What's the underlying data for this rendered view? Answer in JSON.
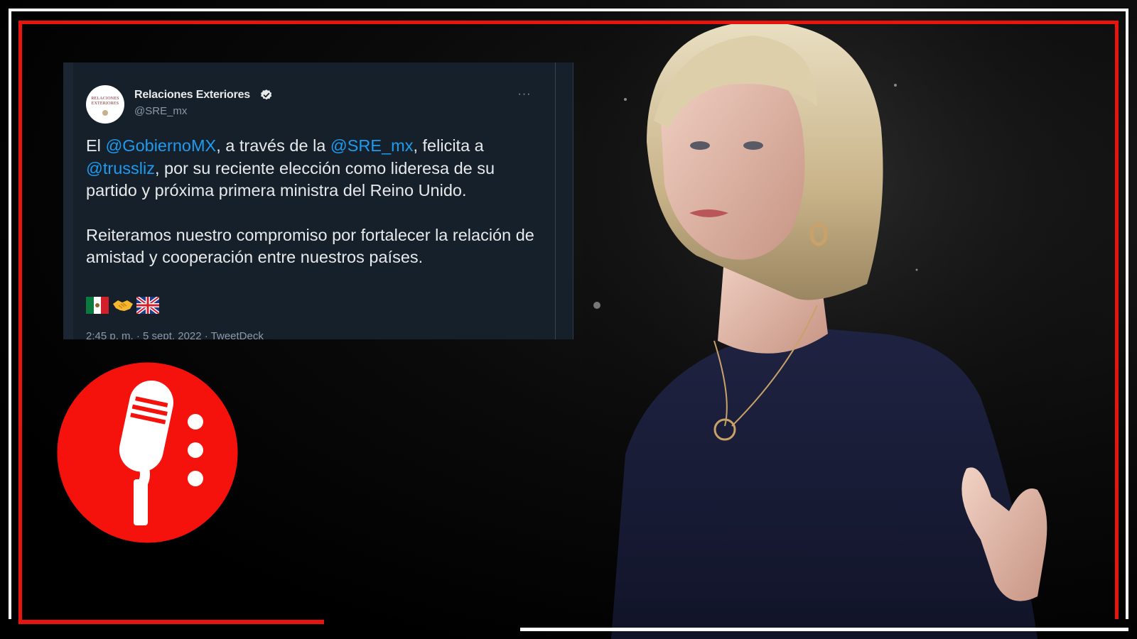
{
  "tweet": {
    "avatar_text": "RELACIONES EXTERIORES",
    "name": "Relaciones Exteriores",
    "handle": "@SRE_mx",
    "more_label": "···",
    "paragraph1": {
      "t1": "El ",
      "m1": "@GobiernoMX",
      "t2": ", a través de la ",
      "m2": "@SRE_mx",
      "t3": ", felicita a ",
      "m3": "@trussliz",
      "t4": ", por su reciente elección como lideresa de su partido y próxima primera ministra del Reino Unido."
    },
    "paragraph2": "Reiteramos nuestro compromiso por fortalecer la relación de amistad y cooperación entre nuestros países.",
    "emojis": [
      "flag-mexico",
      "handshake",
      "flag-united-kingdom"
    ],
    "meta": "2:45 p. m. · 5 sept. 2022 · TweetDeck"
  },
  "colors": {
    "frame_red": "#e8140f",
    "frame_white": "#ffffff",
    "tweet_bg": "#15202b",
    "mention": "#1d9bf0",
    "logo_red": "#f5120c"
  },
  "icons": {
    "verified": "verified-badge-icon",
    "logo": "microphone-icon"
  }
}
